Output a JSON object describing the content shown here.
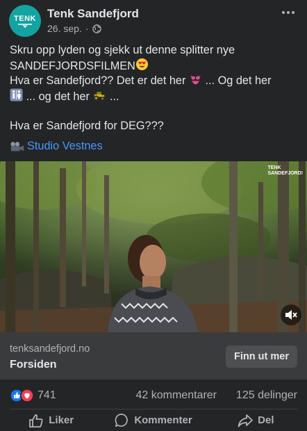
{
  "post": {
    "page_name": "Tenk Sandefjord",
    "date": "26. sep.",
    "separator": "·",
    "avatar_text": "TENK",
    "text_lines": [
      "Skru opp lyden og sjekk ut denne splitter nye",
      "SANDEFJORDSFILMEN",
      "Hva er Sandefjord?? Det er det her",
      "... Og det her",
      "... og det her",
      "...",
      "Hva er Sandefjord for DEG???"
    ],
    "tag": "Studio Vestnes"
  },
  "video": {
    "watermark_line1": "TENK",
    "watermark_line2": "SANDEFJORD!"
  },
  "link_preview": {
    "domain": "tenksandefjord.no",
    "title": "Forsiden",
    "cta_label": "Finn ut mer"
  },
  "engagement": {
    "reactions": "741",
    "comments": "42 kommentarer",
    "shares": "125 delinger"
  },
  "actions": {
    "like": "Liker",
    "comment": "Kommenter",
    "share": "Del"
  },
  "colors": {
    "background": "#242526",
    "link_blue": "#4599ff",
    "avatar_teal": "#13a3a1",
    "card_bg": "#3a3b3c"
  }
}
